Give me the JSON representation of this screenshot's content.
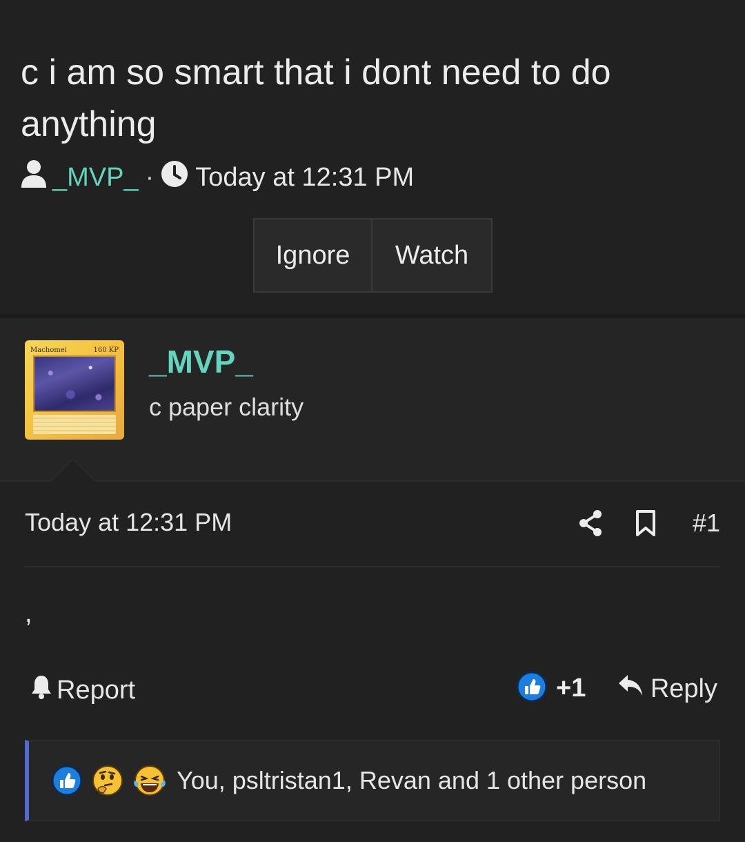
{
  "thread": {
    "title": "c i am so smart that i dont need to do anything",
    "author": "_MVP_",
    "separator": "·",
    "time": "Today at 12:31 PM",
    "buttons": {
      "ignore": "Ignore",
      "watch": "Watch"
    }
  },
  "post": {
    "username": "_MVP_",
    "user_title": "c paper clarity",
    "avatar": {
      "card_name": "Machomei",
      "card_hp": "160 KP"
    },
    "time": "Today at 12:31 PM",
    "number": "#1",
    "body": ",",
    "report_label": "Report",
    "like_count": "+1",
    "reply_label": "Reply",
    "reactions": {
      "icons": [
        "like-icon",
        "thinking-emoji-icon",
        "joy-tears-emoji-icon"
      ],
      "summary": "You, psltristan1, Revan and 1 other person"
    }
  },
  "colors": {
    "background": "#212121",
    "username_accent": "#63d4be",
    "like_blue": "#1c7fe0",
    "reaction_bar_accent": "#4f6bd0"
  }
}
